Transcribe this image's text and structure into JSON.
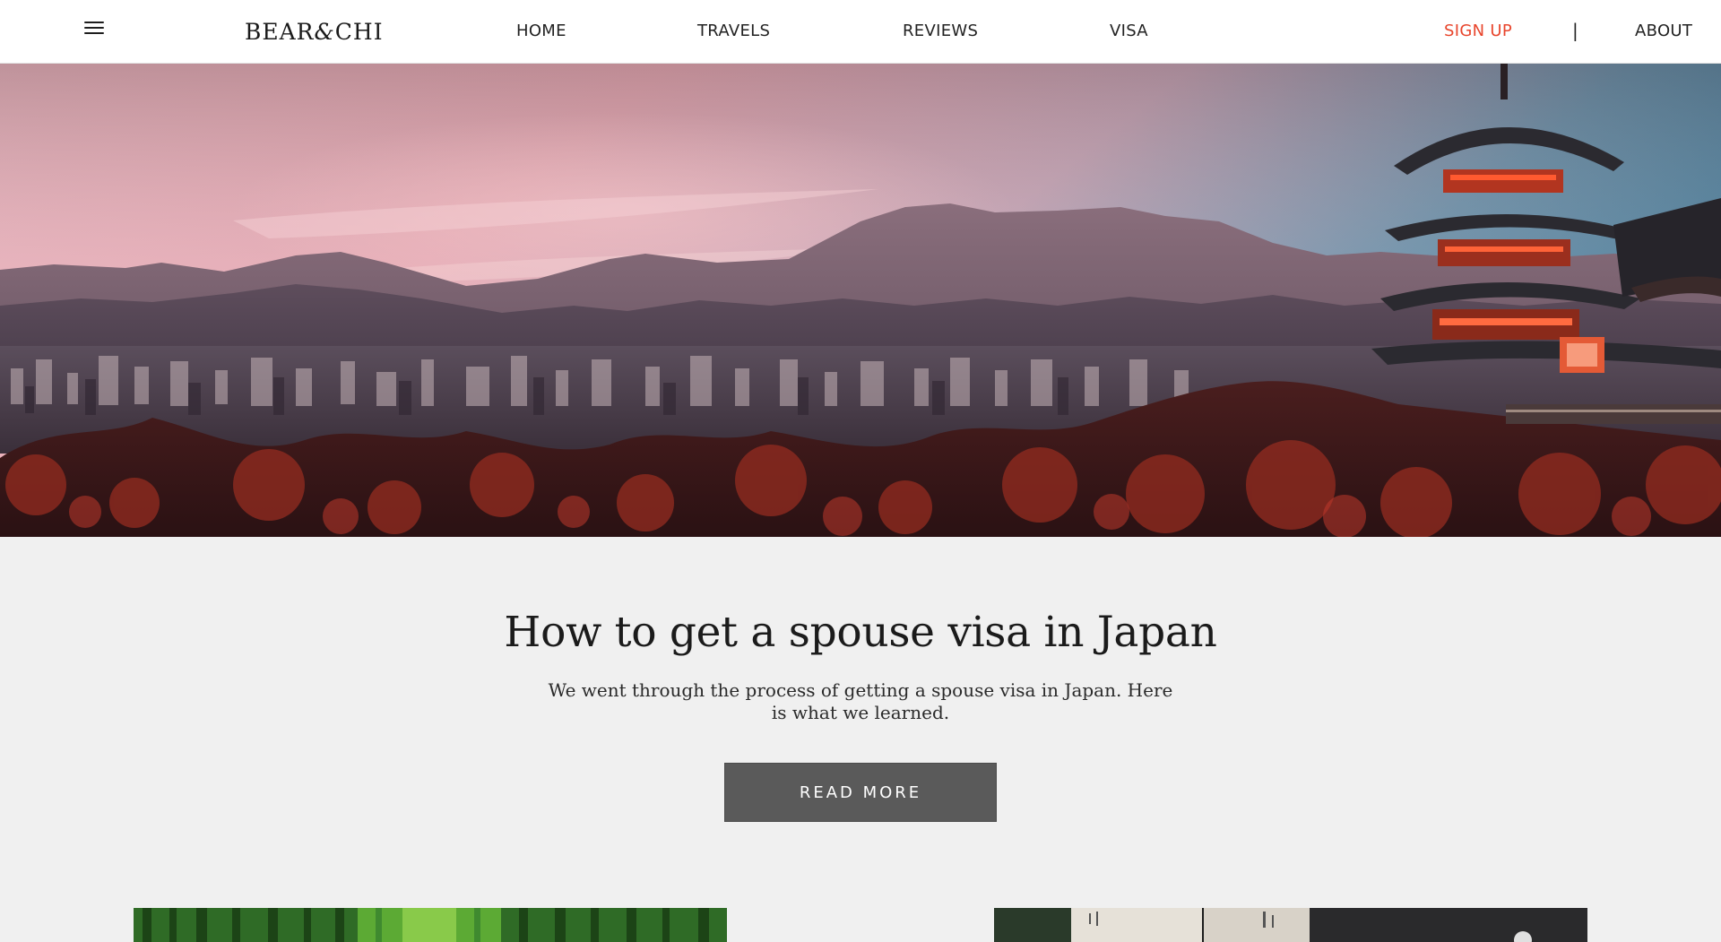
{
  "header": {
    "logo_text": "BEAR&CHI",
    "logo_left": "BEAR",
    "logo_amp": "&",
    "logo_right": "CHI",
    "nav": {
      "home": "HOME",
      "travels": "TRAVELS",
      "reviews": "REVIEWS",
      "visa": "VISA",
      "signup": "SIGN UP",
      "separator": "|",
      "about": "ABOUT"
    }
  },
  "hero": {
    "scene": "kyoto-skyline-pagoda-sunset"
  },
  "feature": {
    "title": "How to get a spouse visa in Japan",
    "description": "We went through the process of getting a spouse visa in Japan. Here is what we learned.",
    "button_label": "READ MORE"
  },
  "cards": [
    {
      "image": "bamboo-forest"
    },
    {
      "image": "japanese-shop-entrance"
    }
  ],
  "colors": {
    "accent": "#e8452c",
    "button_bg": "#5a5a5a",
    "page_bg": "#f0f0f0",
    "header_bg": "#ffffff"
  }
}
